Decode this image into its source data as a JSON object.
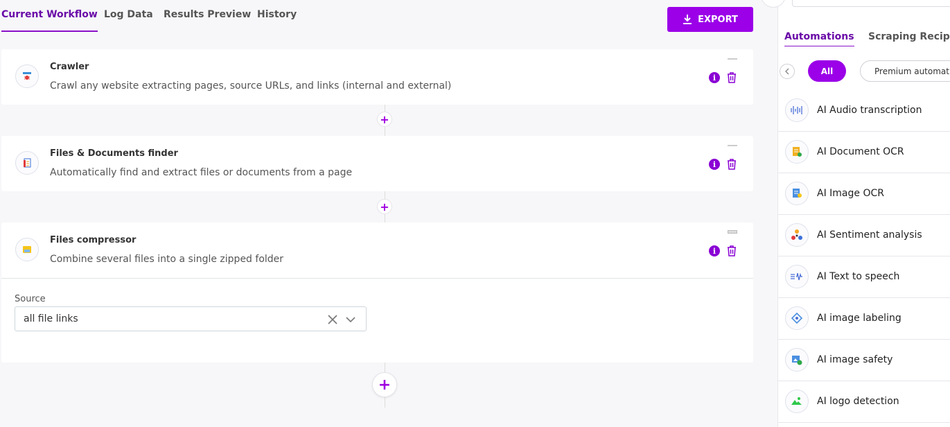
{
  "tabs": [
    {
      "label": "Current Workflow"
    },
    {
      "label": "Log Data"
    },
    {
      "label": "Results Preview"
    },
    {
      "label": "History"
    }
  ],
  "export_label": "EXPORT",
  "steps": [
    {
      "title": "Crawler",
      "description": "Crawl any website extracting pages, source URLs, and links (internal and external)",
      "icon": "crawler-bug-icon"
    },
    {
      "title": "Files & Documents finder",
      "description": "Automatically find and extract files or documents from a page",
      "icon": "document-finder-icon"
    },
    {
      "title": "Files compressor",
      "description": "Combine several files into a single zipped folder",
      "icon": "folder-zip-icon"
    }
  ],
  "source": {
    "label": "Source",
    "value": "all file links"
  },
  "sidebar": {
    "tabs": [
      {
        "label": "Automations"
      },
      {
        "label": "Scraping Recipes"
      }
    ],
    "filters": {
      "all": "All",
      "premium": "Premium automations"
    },
    "items": [
      {
        "label": "AI Audio transcription",
        "icon": "audio-wave-icon"
      },
      {
        "label": "AI Document OCR",
        "icon": "document-ocr-icon"
      },
      {
        "label": "AI Image OCR",
        "icon": "image-ocr-icon"
      },
      {
        "label": "AI Sentiment analysis",
        "icon": "sentiment-icon"
      },
      {
        "label": "AI Text to speech",
        "icon": "text-to-speech-icon"
      },
      {
        "label": "AI image labeling",
        "icon": "image-label-icon"
      },
      {
        "label": "AI image safety",
        "icon": "image-safety-icon"
      },
      {
        "label": "AI logo detection",
        "icon": "logo-detection-icon"
      }
    ]
  },
  "colors": {
    "accent": "#9b00e8",
    "active_tab": "#6a0aa8"
  }
}
